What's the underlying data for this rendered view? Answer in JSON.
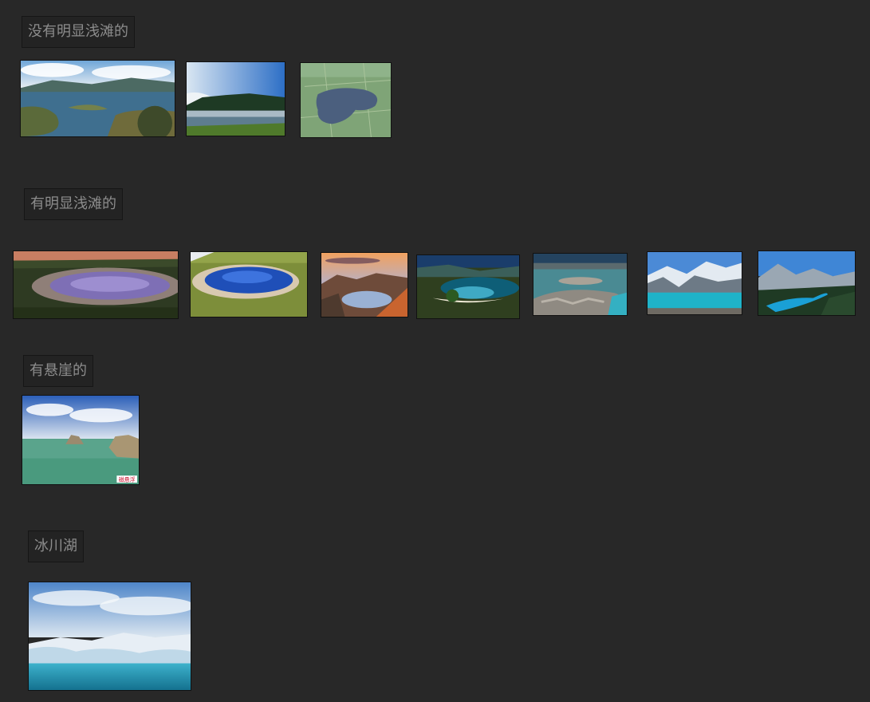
{
  "groups": [
    {
      "label": "没有明显浅滩的",
      "images": [
        "lake-aerial-islands",
        "mountain-lake-mist",
        "aerial-green-lake"
      ]
    },
    {
      "label": "有明显浅滩的",
      "images": [
        "crater-lake-pink",
        "blue-pond-shore",
        "sunset-lake-canyon",
        "turquoise-bay-beach",
        "rocky-shoal-lake",
        "glacier-turquoise-lake",
        "peyto-lake"
      ]
    },
    {
      "label": "有悬崖的",
      "images": [
        "cliff-seaside-lake"
      ],
      "watermark": "磁悬浮"
    },
    {
      "label": "冰川湖",
      "images": [
        "iceberg-lake"
      ]
    }
  ]
}
